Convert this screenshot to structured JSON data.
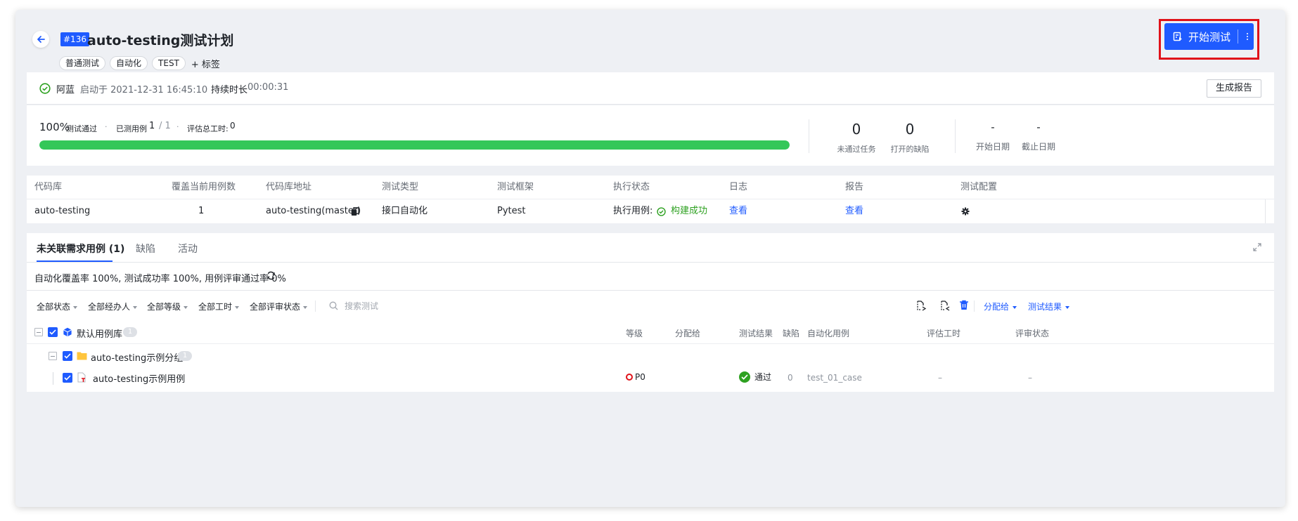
{
  "header": {
    "id_badge": "#136",
    "title": "auto-testing测试计划",
    "tags": [
      "普通测试",
      "自动化",
      "TEST"
    ],
    "add_tag_label": "+ 标签",
    "start_button_label": "开始测试"
  },
  "status": {
    "user": "阿蓝",
    "started_at": "启动于 2021-12-31 16:45:10",
    "duration_label": "持续时长",
    "duration_value": "00:00:31",
    "report_button": "生成报告"
  },
  "progress": {
    "percent_text": "100%",
    "percent_label": "测试通过",
    "dot": "·",
    "tested_label": "已测用例",
    "tested_value": "1",
    "tested_total": "/ 1",
    "hours_label": "评估总工时:",
    "hours_value": "0",
    "fill_fraction": 1.0,
    "stats": [
      {
        "value": "0",
        "label": "未通过任务"
      },
      {
        "value": "0",
        "label": "打开的缺陷"
      }
    ],
    "dates": [
      {
        "value": "-",
        "label": "开始日期"
      },
      {
        "value": "-",
        "label": "截止日期"
      }
    ]
  },
  "repo_table": {
    "headers": [
      "代码库",
      "覆盖当前用例数",
      "代码库地址",
      "测试类型",
      "测试框架",
      "执行状态",
      "日志",
      "报告",
      "测试配置"
    ],
    "row": {
      "repo": "auto-testing",
      "cases": "1",
      "address": "auto-testing(master)",
      "type": "接口自动化",
      "framework": "Pytest",
      "exec_prefix": "执行用例:",
      "exec_status": "构建成功",
      "log": "查看",
      "report": "查看"
    }
  },
  "tabs": [
    {
      "label": "未关联需求用例 (1)"
    },
    {
      "label": "缺陷"
    },
    {
      "label": "活动"
    }
  ],
  "coverage_text": "自动化覆盖率 100%, 测试成功率 100%, 用例评审通过率 0%",
  "filters": [
    "全部状态",
    "全部经办人",
    "全部等级",
    "全部工时",
    "全部评审状态"
  ],
  "search_placeholder": "搜索测试",
  "right_filters": [
    "分配给",
    "测试结果"
  ],
  "case_list": {
    "headers": [
      "等级",
      "分配给",
      "测试结果",
      "缺陷",
      "自动化用例",
      "评估工时",
      "评审状态"
    ],
    "library": {
      "name": "默认用例库",
      "count": "1"
    },
    "group": {
      "name": "auto-testing示例分组",
      "count": "1"
    },
    "case": {
      "name": "auto-testing示例用例",
      "priority": "P0",
      "result": "通过",
      "defects": "0",
      "auto_case": "test_01_case",
      "hours": "–",
      "review": "–"
    }
  },
  "colors": {
    "primary": "#1f5bff",
    "success": "#34c759",
    "highlight": "#e0121a"
  }
}
